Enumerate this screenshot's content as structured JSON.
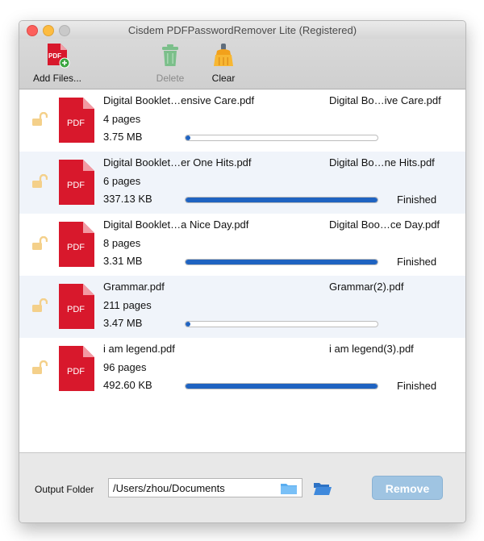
{
  "window": {
    "title": "Cisdem PDFPasswordRemover Lite (Registered)"
  },
  "toolbar": {
    "add_files_label": "Add Files...",
    "delete_label": "Delete",
    "clear_label": "Clear",
    "pdf_icon_text": "PDF"
  },
  "files": [
    {
      "name": "Digital Booklet…ensive Care.pdf",
      "output": "Digital Bo…ive Care.pdf",
      "pages": "4 pages",
      "size": "3.75 MB",
      "progress": 0.0,
      "status": ""
    },
    {
      "name": "Digital Booklet…er One Hits.pdf",
      "output": "Digital Bo…ne Hits.pdf",
      "pages": "6 pages",
      "size": "337.13 KB",
      "progress": 1.0,
      "status": "Finished"
    },
    {
      "name": "Digital Booklet…a Nice Day.pdf",
      "output": "Digital Boo…ce Day.pdf",
      "pages": "8 pages",
      "size": "3.31 MB",
      "progress": 1.0,
      "status": "Finished"
    },
    {
      "name": "Grammar.pdf",
      "output": "Grammar(2).pdf",
      "pages": "211 pages",
      "size": "3.47 MB",
      "progress": 0.0,
      "status": ""
    },
    {
      "name": "i am legend.pdf",
      "output": "i am legend(3).pdf",
      "pages": "96 pages",
      "size": "492.60 KB",
      "progress": 1.0,
      "status": "Finished"
    }
  ],
  "file_icon_text": "PDF",
  "output": {
    "label": "Output Folder",
    "path": "/Users/zhou/Documents",
    "remove_label": "Remove"
  },
  "colors": {
    "accent": "#1f63c1",
    "pdf_red": "#d8182c",
    "remove_disabled": "#9fc4e2"
  }
}
